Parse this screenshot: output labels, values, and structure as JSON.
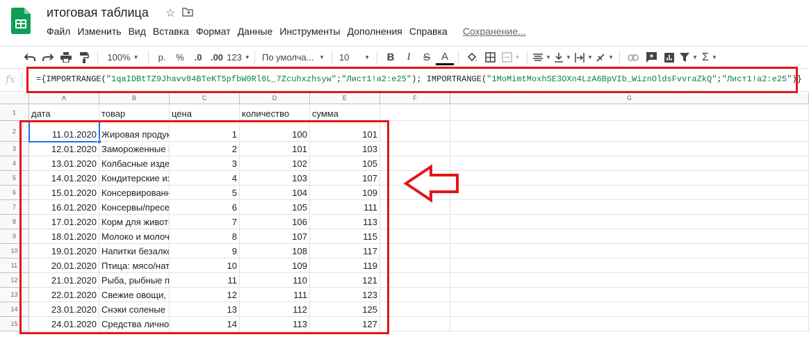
{
  "app": {
    "title": "итоговая таблица",
    "accent": "#0f9d58"
  },
  "menu": [
    "Файл",
    "Изменить",
    "Вид",
    "Вставка",
    "Формат",
    "Данные",
    "Инструменты",
    "Дополнения",
    "Справка"
  ],
  "status": "Сохранение...",
  "toolbar": {
    "zoom": "100%",
    "currency": "р.",
    "percent": "%",
    "dec_less": ".0",
    "dec_more": ".00",
    "num_format": "123",
    "font": "По умолча...",
    "font_size": "10",
    "bold": "B",
    "italic": "I",
    "strike": "S",
    "text_color": "A",
    "sum": "Σ"
  },
  "formula_bar": {
    "fx": "fx",
    "part1": "={IMPORTRANGE(",
    "str1": "\"1qaIDBtTZ9Jhavv84BTeKT5pfbW0Rl6L_7Zcuhxzhsyw\"",
    "semi1": ";",
    "str2": "\"Лист1!a2:e25\"",
    "part2": "); IMPORTRANGE(",
    "str3": "\"1MoMimtMoxhSE3OXn4LzA6BpVIb_WiznOldsFvvraZkQ\"",
    "semi2": ";",
    "str4": "\"Лист1!a2:e25\"",
    "part3": ")}"
  },
  "columns": [
    "A",
    "B",
    "C",
    "D",
    "E",
    "F",
    "G"
  ],
  "headers": [
    "дата",
    "товар",
    "цена",
    "количество",
    "сумма"
  ],
  "rows": [
    {
      "n": "1"
    },
    {
      "n": "2",
      "date": "11.01.2020",
      "item": "Жировая продукция",
      "price": "1",
      "qty": "100",
      "sum": "101"
    },
    {
      "n": "3",
      "date": "12.01.2020",
      "item": "Замороженные продукты",
      "price": "2",
      "qty": "101",
      "sum": "103"
    },
    {
      "n": "4",
      "date": "13.01.2020",
      "item": "Колбасные изделия",
      "price": "3",
      "qty": "102",
      "sum": "105"
    },
    {
      "n": "5",
      "date": "14.01.2020",
      "item": "Кондитерские изделия",
      "price": "4",
      "qty": "103",
      "sum": "107"
    },
    {
      "n": "6",
      "date": "15.01.2020",
      "item": "Консервированные",
      "price": "5",
      "qty": "104",
      "sum": "109"
    },
    {
      "n": "7",
      "date": "16.01.2020",
      "item": "Консервы/пресервы",
      "price": "6",
      "qty": "105",
      "sum": "111"
    },
    {
      "n": "8",
      "date": "17.01.2020",
      "item": "Корм для животных",
      "price": "7",
      "qty": "106",
      "sum": "113"
    },
    {
      "n": "9",
      "date": "18.01.2020",
      "item": "Молоко и молочные",
      "price": "8",
      "qty": "107",
      "sum": "115"
    },
    {
      "n": "10",
      "date": "19.01.2020",
      "item": "Напитки безалкогольные",
      "price": "9",
      "qty": "108",
      "sum": "117"
    },
    {
      "n": "11",
      "date": "20.01.2020",
      "item": "Птица: мясо/натуральное",
      "price": "10",
      "qty": "109",
      "sum": "119"
    },
    {
      "n": "12",
      "date": "21.01.2020",
      "item": "Рыба, рыбные продукты",
      "price": "11",
      "qty": "110",
      "sum": "121"
    },
    {
      "n": "13",
      "date": "22.01.2020",
      "item": "Свежие овощи, фрукты",
      "price": "12",
      "qty": "111",
      "sum": "123"
    },
    {
      "n": "14",
      "date": "23.01.2020",
      "item": "Снэки соленые",
      "price": "13",
      "qty": "112",
      "sum": "125"
    },
    {
      "n": "15",
      "date": "24.01.2020",
      "item": "Средства личной",
      "price": "14",
      "qty": "113",
      "sum": "127"
    }
  ]
}
